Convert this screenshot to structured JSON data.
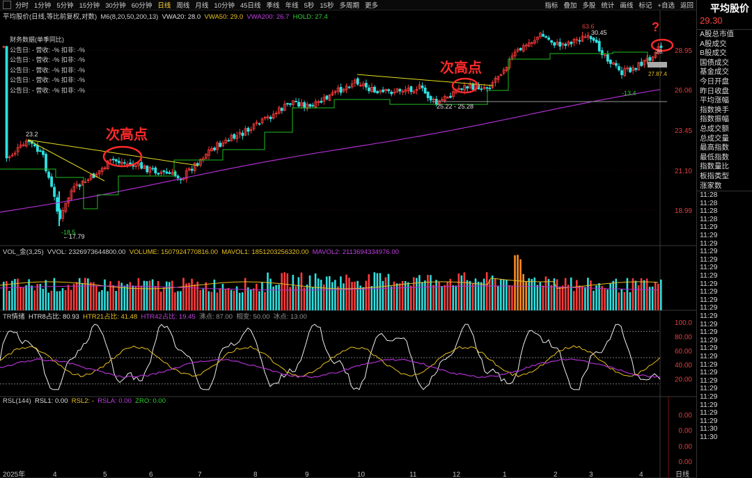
{
  "toolbar": {
    "periods": [
      "分时",
      "1分钟",
      "5分钟",
      "15分钟",
      "30分钟",
      "60分钟",
      "日线",
      "周线",
      "月线",
      "10分钟",
      "45日线",
      "季线",
      "年线",
      "5秒",
      "15秒",
      "多周期",
      "更多"
    ],
    "active": "日线",
    "right_buttons": [
      "指标",
      "叠加",
      "多股",
      "统计",
      "画线",
      "标记",
      "+自选",
      "返回"
    ]
  },
  "right_panel": {
    "title": "平均股价",
    "price": "29.30",
    "items": [
      "A股总市值",
      "A股成交",
      "B股成交",
      "国债成交",
      "基金成交",
      "今日开盘",
      "昨日收盘",
      "平均涨幅",
      "指数换手",
      "指数振幅",
      "总成交额",
      "总成交量",
      "最高指数",
      "最低指数",
      "指数量比",
      "板指类型",
      "涨家数"
    ],
    "times": [
      "11:28",
      "11:28",
      "11:28",
      "11:28",
      "11:29",
      "11:29",
      "11:29",
      "11:29",
      "11:29",
      "11:29",
      "11:29",
      "11:29",
      "11:29",
      "11:29",
      "11:29",
      "11:29",
      "11:29",
      "11:29",
      "11:29",
      "11:29",
      "11:29",
      "11:29",
      "11:29",
      "11:29",
      "11:29",
      "11:29",
      "11:29",
      "11:29",
      "11:29",
      "11:30",
      "11:30"
    ],
    "bottom_label": "日线"
  },
  "main_pane": {
    "title": "平均股价(日线,等比前复权,对数)",
    "ma_label": "M6(8,20,50,200,13)",
    "vwa20": "VWA20: 28.0",
    "vwa50": "VWA50: 29.0",
    "vwa200": "VWA200: 26.7",
    "hold": "HOLD: 27.4",
    "y_ticks": [
      "28.95",
      "26.06",
      "23.45",
      "21.10",
      "18.99"
    ],
    "fin_title": "财务数据(单季同比)",
    "fin_rows": [
      "公告日: -    营收: -%    扣非: -%",
      "公告日: -    营收: -%    扣非: -%",
      "公告日: -    营收: -%    扣非: -%",
      "公告日: -    营收: -%    扣非: -%",
      "公告日: -    营收: -%    扣非: -%"
    ],
    "labels": {
      "high1": "23.2",
      "low1": "-18.5",
      "low1_arrow": "←17.79",
      "high2": "63.6",
      "high2b": "30.45",
      "mid": "25.22 - 25.28",
      "neg": "-13.4",
      "right_a": "28.",
      "right_b": "27.87.4"
    },
    "annotation_1": "次高点",
    "annotation_2": "次高点",
    "question": "?"
  },
  "vol_pane": {
    "title": "VOL_金(3,25)",
    "vvol": "VVOL: 2326973644800.00",
    "volume": "VOLUME: 1507924770816.00",
    "mavol1": "MAVOL1: 1851203256320.00",
    "mavol2": "MAVOL2: 2113694334976.00"
  },
  "tr_pane": {
    "title": "TR情绪",
    "htr8": "HTR8占比: 80.93",
    "htr21": "HTR21占比: 41.48",
    "htr42": "HTR42占比: 19.45",
    "boil": "沸点: 87.00",
    "mid": "相变: 50.00",
    "ice": "冰点: 13.00",
    "y_ticks": [
      "100.0",
      "80.00",
      "60.00",
      "40.00",
      "20.00"
    ]
  },
  "rsl_pane": {
    "title": "RSL(144)",
    "rsl1": "RSL1: 0.00",
    "rsl2": "RSL2: -",
    "rsla": "RSLA: 0.00",
    "zro": "ZRO: 0.00",
    "y_ticks": [
      "0.00",
      "0.00",
      "0.00",
      "0.00"
    ]
  },
  "x_axis": [
    "2025年",
    "4",
    "5",
    "6",
    "7",
    "8",
    "9",
    "10",
    "11",
    "12",
    "1",
    "2",
    "3",
    "4"
  ],
  "colors": {
    "up": "#ff3b3b",
    "down": "#2fe0e0",
    "ma_green": "#20c020",
    "ma_purple": "#b030d0",
    "trend": "#e8e020",
    "annotation": "#ff2a2a"
  }
}
